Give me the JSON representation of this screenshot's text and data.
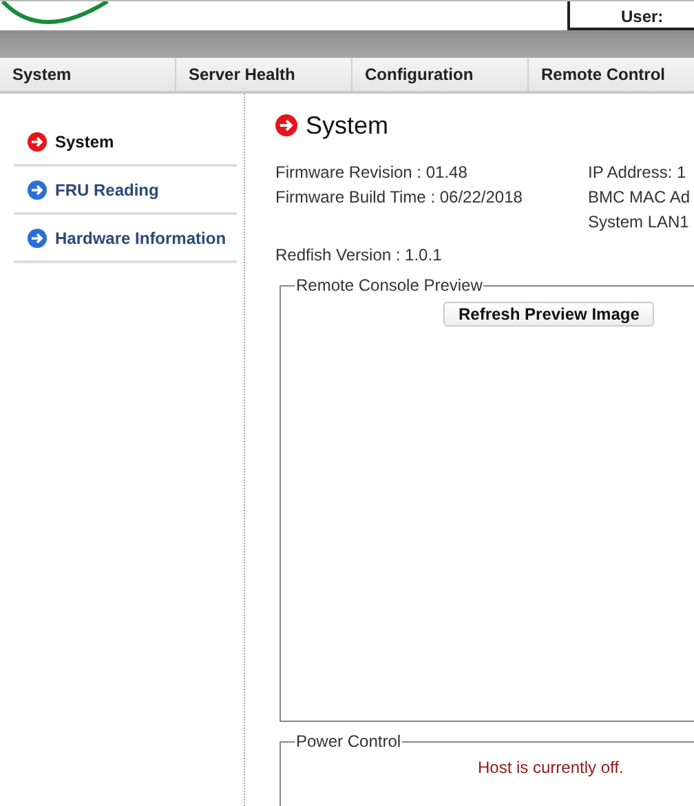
{
  "header": {
    "user_label": "User:"
  },
  "nav": [
    {
      "label": "System",
      "selected": false
    },
    {
      "label": "Server Health",
      "selected": false
    },
    {
      "label": "Configuration",
      "selected": false
    },
    {
      "label": "Remote Control",
      "selected": false
    }
  ],
  "sidebar": {
    "items": [
      {
        "label": "System",
        "selected": true
      },
      {
        "label": "FRU Reading",
        "selected": false
      },
      {
        "label": "Hardware Information",
        "selected": false
      }
    ]
  },
  "page_title": "System",
  "info_left": [
    "Firmware Revision : 01.48",
    "Firmware Build Time : 06/22/2018"
  ],
  "info_right": [
    "IP Address: 1",
    "BMC MAC Ad",
    "System LAN1"
  ],
  "redfish": "Redfish Version : 1.0.1",
  "console": {
    "legend": "Remote Console Preview",
    "button": "Refresh Preview Image"
  },
  "power": {
    "legend": "Power Control",
    "status": "Host is currently off."
  }
}
